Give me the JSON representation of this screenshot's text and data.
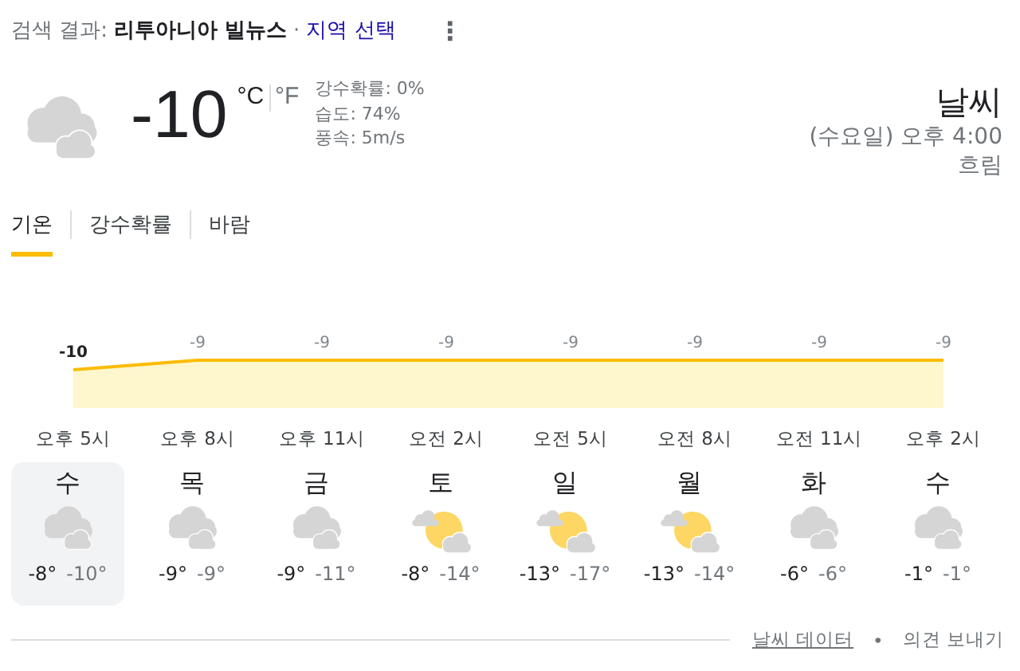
{
  "header": {
    "prefix": "검색 결과:",
    "location": "리투아니아 빌뉴스",
    "separator": "·",
    "link": "지역 선택",
    "menu": "⋮"
  },
  "current": {
    "kind": "cloudy",
    "temperature": "-10",
    "units": [
      {
        "label": "°C",
        "selected": true
      },
      {
        "label": "°F",
        "selected": false
      }
    ],
    "details": [
      "강수확률: 0%",
      "습도: 74%",
      "풍속: 5m/s"
    ],
    "title": "날씨",
    "time": "(수요일) 오후 4:00",
    "condition": "흐림"
  },
  "tabs": [
    {
      "label": "기온",
      "selected": true
    },
    {
      "label": "강수확률",
      "selected": false
    },
    {
      "label": "바람",
      "selected": false
    }
  ],
  "chart": {
    "chart_data": {
      "type": "area",
      "categories": [
        "오후 5시",
        "오후 8시",
        "오후 11시",
        "오전 2시",
        "오전 5시",
        "오전 8시",
        "오전 11시",
        "오후 2시"
      ],
      "series": [
        {
          "color": "#fbbc04",
          "values": [
            -10,
            -9,
            -9,
            -9,
            -9,
            -9,
            -9,
            -9
          ]
        }
      ],
      "data_labels": true
    }
  },
  "days": [
    {
      "day": "수",
      "kind": "cloudy",
      "high": "-8°",
      "low": "-10°",
      "selected": true
    },
    {
      "day": "목",
      "kind": "cloudy",
      "high": "-9°",
      "low": "-9°",
      "selected": false
    },
    {
      "day": "금",
      "kind": "cloudy",
      "high": "-9°",
      "low": "-11°",
      "selected": false
    },
    {
      "day": "토",
      "kind": "partly_cloudy",
      "high": "-8°",
      "low": "-14°",
      "selected": false
    },
    {
      "day": "일",
      "kind": "partly_cloudy",
      "high": "-13°",
      "low": "-17°",
      "selected": false
    },
    {
      "day": "월",
      "kind": "partly_cloudy",
      "high": "-13°",
      "low": "-14°",
      "selected": false
    },
    {
      "day": "화",
      "kind": "cloudy",
      "high": "-6°",
      "low": "-6°",
      "selected": false
    },
    {
      "day": "수",
      "kind": "cloudy",
      "high": "-1°",
      "low": "-1°",
      "selected": false
    }
  ],
  "footer": {
    "link": "날씨 데이터",
    "separator": "•",
    "feedback": "의견 보내기"
  }
}
